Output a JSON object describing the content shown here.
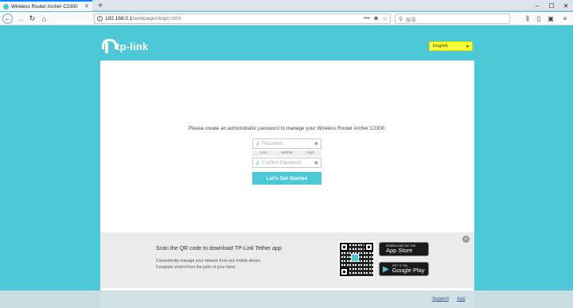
{
  "browser": {
    "tab_title": "Wireless Router Archer C2300",
    "url_host": "192.168.0.1",
    "url_path": "/webpages/login.html",
    "search_placeholder": "搜尋"
  },
  "page": {
    "brand": "tp-link",
    "language": "English",
    "prompt": "Please create an administrator password to manage your Wireless Router Archer C2300.",
    "password_placeholder": "Password",
    "confirm_placeholder": "Confirm Password",
    "strength": [
      "Low",
      "Middle",
      "High"
    ],
    "cta_label": "Let's Get Started"
  },
  "promo": {
    "title": "Scan the QR code to download TP-Link Tether app",
    "desc_line1": "Conveniently manage your network from any mobile device.",
    "desc_line2": "Complete control from the palm of your hand.",
    "appstore_small": "DOWNLOAD ON THE",
    "appstore_big": "App Store",
    "play_small": "GET IT ON",
    "play_big": "Google Play"
  },
  "footer": {
    "support": "Support",
    "app": "App"
  },
  "colors": {
    "accent": "#4dc8d6",
    "highlight": "#ffff33"
  }
}
